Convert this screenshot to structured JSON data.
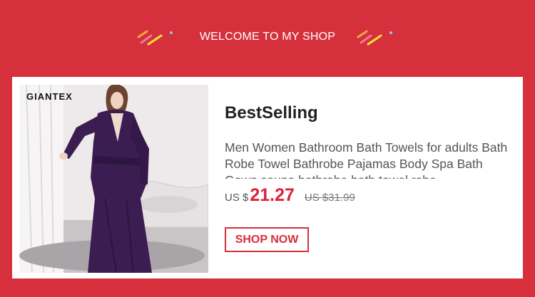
{
  "header": {
    "title": "WELCOME TO MY SHOP",
    "decoration_icon": "confetti-lines-icon"
  },
  "product": {
    "brand_logo": "GIANTEX",
    "section_title": "BestSelling",
    "description": "Men Women Bathroom Bath Towels for adults Bath Robe Towel Bathrobe Pajamas Body Spa Bath Gown sauna bathrobe bath towel robe",
    "currency": "US $",
    "price": "21.27",
    "original_price": "US $31.99",
    "button_label": "SHOP NOW"
  },
  "colors": {
    "background": "#d6303c",
    "price": "#e0203a",
    "button_border": "#d6303c",
    "robe": "#3b1d52"
  }
}
